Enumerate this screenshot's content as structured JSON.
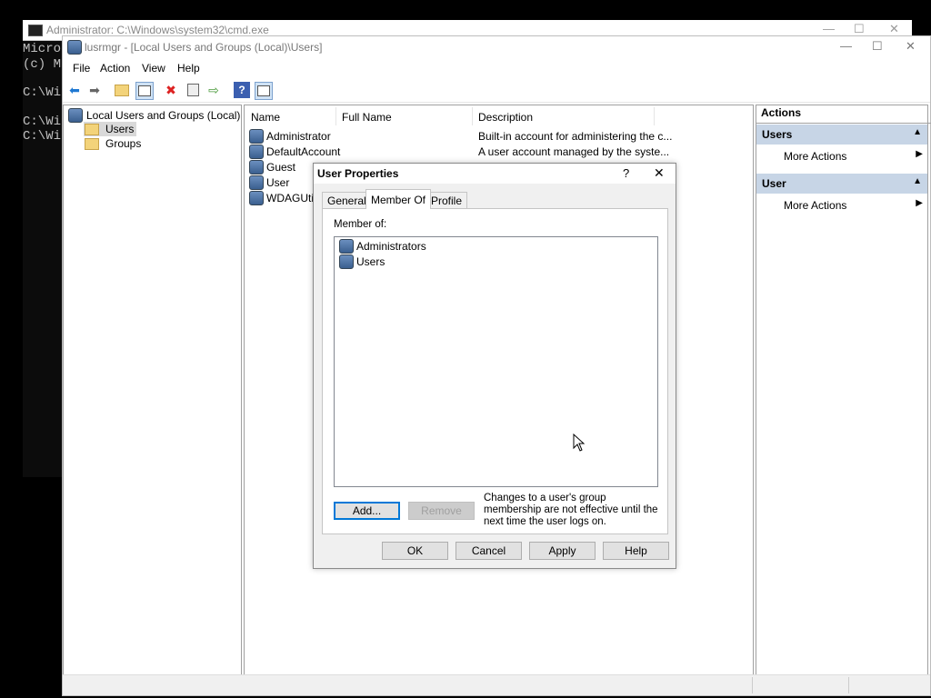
{
  "cmd": {
    "title": "Administrator: C:\\Windows\\system32\\cmd.exe",
    "icon": "cmd-icon",
    "lines": [
      "Micro",
      "(c) M",
      "",
      "C:\\Wi",
      "",
      "C:\\Wi",
      "C:\\Wi"
    ]
  },
  "mmc": {
    "title": "lusrmgr - [Local Users and Groups (Local)\\Users]",
    "window_controls": {
      "minimize": "—",
      "maximize": "☐",
      "close": "✕"
    },
    "menu": [
      "File",
      "Action",
      "View",
      "Help"
    ],
    "toolbar_icons": [
      "back-icon",
      "forward-icon",
      "up-folder-icon",
      "show-hide-tree-icon",
      "delete-icon",
      "properties-icon",
      "export-list-icon",
      "help-icon",
      "show-hide-action-pane-icon"
    ],
    "tree": {
      "root": "Local Users and Groups (Local)",
      "children": [
        "Users",
        "Groups"
      ],
      "selected": "Users"
    },
    "list": {
      "columns": [
        "Name",
        "Full Name",
        "Description"
      ],
      "rows": [
        {
          "name": "Administrator",
          "full_name": "",
          "description": "Built-in account for administering the c..."
        },
        {
          "name": "DefaultAccount",
          "full_name": "",
          "description": "A user account managed by the syste..."
        },
        {
          "name": "Guest",
          "full_name": "",
          "description": ""
        },
        {
          "name": "User",
          "full_name": "",
          "description": ""
        },
        {
          "name": "WDAGUtilit",
          "full_name": "",
          "description": ""
        }
      ]
    },
    "actions": {
      "header": "Actions",
      "sections": [
        {
          "title": "Users",
          "items": [
            "More Actions"
          ]
        },
        {
          "title": "User",
          "items": [
            "More Actions"
          ]
        }
      ]
    }
  },
  "dialog": {
    "title": "User Properties",
    "help_glyph": "?",
    "close_glyph": "✕",
    "tabs": [
      "General",
      "Member Of",
      "Profile"
    ],
    "active_tab": "Member Of",
    "member_of_label": "Member of:",
    "members": [
      "Administrators",
      "Users"
    ],
    "add_label": "Add...",
    "remove_label": "Remove",
    "note": "Changes to a user's group membership are not effective until the next time the user logs on.",
    "ok_label": "OK",
    "cancel_label": "Cancel",
    "apply_label": "Apply",
    "help_label": "Help"
  },
  "colors": {
    "accent": "#0078d7",
    "action_section": "#c7d5e6",
    "selection": "#cce8ff"
  }
}
